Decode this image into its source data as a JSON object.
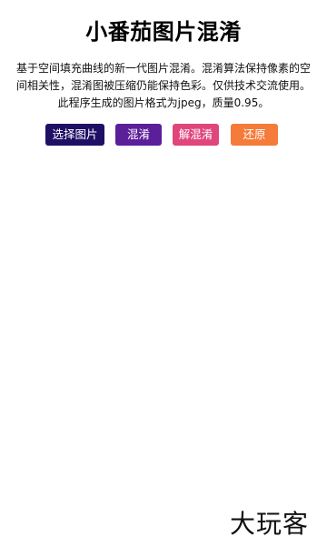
{
  "header": {
    "title": "小番茄图片混淆",
    "description": "基于空间填充曲线的新一代图片混淆。混淆算法保持像素的空间相关性，混淆图被压缩仍能保持色彩。仅供技术交流使用。此程序生成的图片格式为jpeg，质量0.95。"
  },
  "toolbar": {
    "select_label": "选择图片",
    "obfuscate_label": "混淆",
    "deobfuscate_label": "解混淆",
    "restore_label": "还原"
  },
  "colors": {
    "select_button": "#1f1066",
    "obfuscate_button": "#5b1f9a",
    "deobfuscate_button": "#e0457b",
    "restore_button": "#f47b3a",
    "background": "#ffffff",
    "text": "#000000"
  },
  "watermark": {
    "text": "大玩客"
  }
}
